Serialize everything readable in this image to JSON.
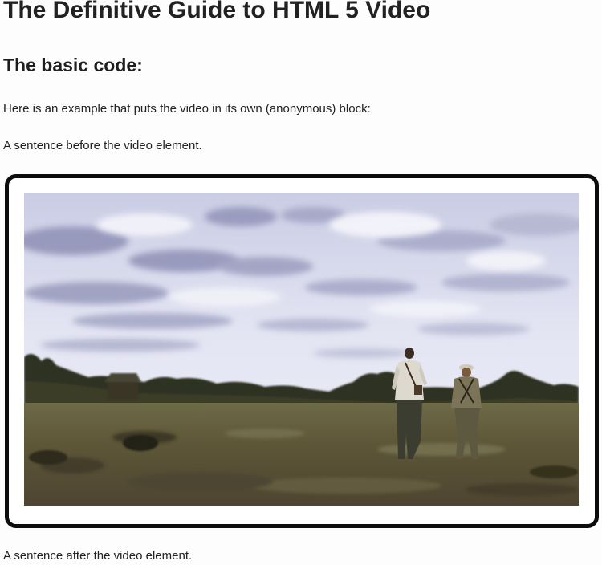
{
  "page": {
    "title": "The Definitive Guide to HTML 5 Video",
    "section_heading": "The basic code:",
    "intro_text": "Here is an example that puts the video in its own (anonymous) block:",
    "before_text": "A sentence before the video element.",
    "after_text": "A sentence after the video element."
  },
  "video": {
    "scene": "two-men-walking-in-grassland-under-cloudy-sky",
    "frame_border_color": "#0d0d0d",
    "sky_color": "#d9dbee",
    "cloud_color": "#8c8fb5",
    "grass_color": "#5f563a"
  }
}
